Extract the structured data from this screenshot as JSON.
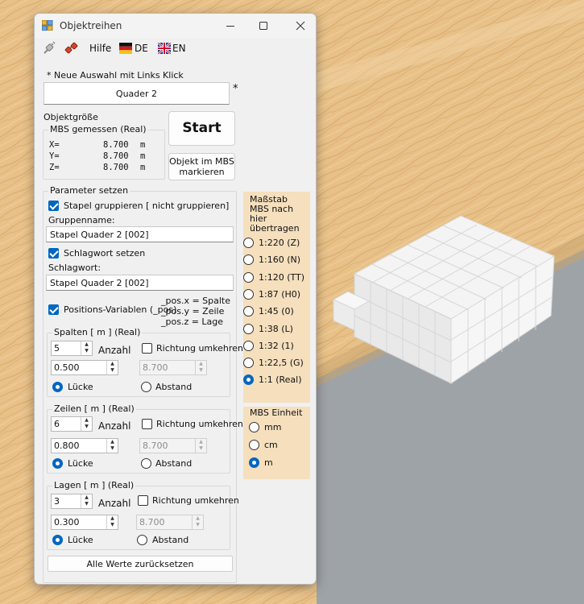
{
  "window": {
    "title": "Objektreihen"
  },
  "menu": {
    "help": "Hilfe",
    "lang_de": "DE",
    "lang_en": "EN"
  },
  "selection": {
    "hint": "* Neue Auswahl mit Links Klick",
    "object_name": "Quader 2",
    "asterisk": "*"
  },
  "size": {
    "heading": "Objektgröße",
    "group_title": "MBS  gemessen (Real)",
    "rows": [
      {
        "axis": "X=",
        "value": "8.700",
        "unit": "m"
      },
      {
        "axis": "Y=",
        "value": "8.700",
        "unit": "m"
      },
      {
        "axis": "Z=",
        "value": "8.700",
        "unit": "m"
      }
    ]
  },
  "buttons": {
    "start": "Start",
    "mark_line1": "Objekt im MBS",
    "mark_line2": "markieren",
    "reset": "Alle Werte zurücksetzen"
  },
  "params": {
    "title": "Parameter setzen",
    "group_stack_label": "Stapel gruppieren [ nicht gruppieren]",
    "group_name_label": "Gruppenname:",
    "group_name_value": "Stapel Quader 2 [002]",
    "keyword_set_label": "Schlagwort setzen",
    "keyword_label": "Schlagwort:",
    "keyword_value": "Stapel Quader 2 [002]",
    "pos_vars_label": "Positions-Variablen (_pos)",
    "pos_hint": [
      "_pos.x = Spalte",
      "_pos.y = Zeile",
      "_pos.z = Lage"
    ]
  },
  "columns": {
    "title": "Spalten [ m ] (Real)",
    "count": "5",
    "count_label": "Anzahl",
    "reverse_label": "Richtung umkehren",
    "gap_value": "0.500",
    "distance_value": "8.700",
    "gap_label": "Lücke",
    "distance_label": "Abstand"
  },
  "rows_group": {
    "title": "Zeilen [  m ] (Real)",
    "count": "6",
    "count_label": "Anzahl",
    "reverse_label": "Richtung umkehren",
    "gap_value": "0.800",
    "distance_value": "8.700",
    "gap_label": "Lücke",
    "distance_label": "Abstand"
  },
  "layers": {
    "title": "Lagen [ m ] (Real)",
    "count": "3",
    "count_label": "Anzahl",
    "reverse_label": "Richtung umkehren",
    "gap_value": "0.300",
    "distance_value": "8.700",
    "gap_label": "Lücke",
    "distance_label": "Abstand"
  },
  "scale": {
    "heading": [
      "Maßstab",
      "MBS nach",
      "hier",
      "übertragen"
    ],
    "options": [
      "1:220 (Z)",
      "1:160 (N)",
      "1:120 (TT)",
      "1:87 (H0)",
      "1:45 (0)",
      "1:38 (L)",
      "1:32 (1)",
      "1:22,5 (G)",
      "1:1 (Real)"
    ],
    "selected": "1:1 (Real)"
  },
  "unit": {
    "heading": "MBS Einheit",
    "options": [
      "mm",
      "cm",
      "m"
    ],
    "selected": "m"
  },
  "colors": {
    "accent": "#0067c0",
    "panel": "#f5dfbd",
    "wood": "#e9c48c",
    "floor": "#9aa0a6"
  }
}
